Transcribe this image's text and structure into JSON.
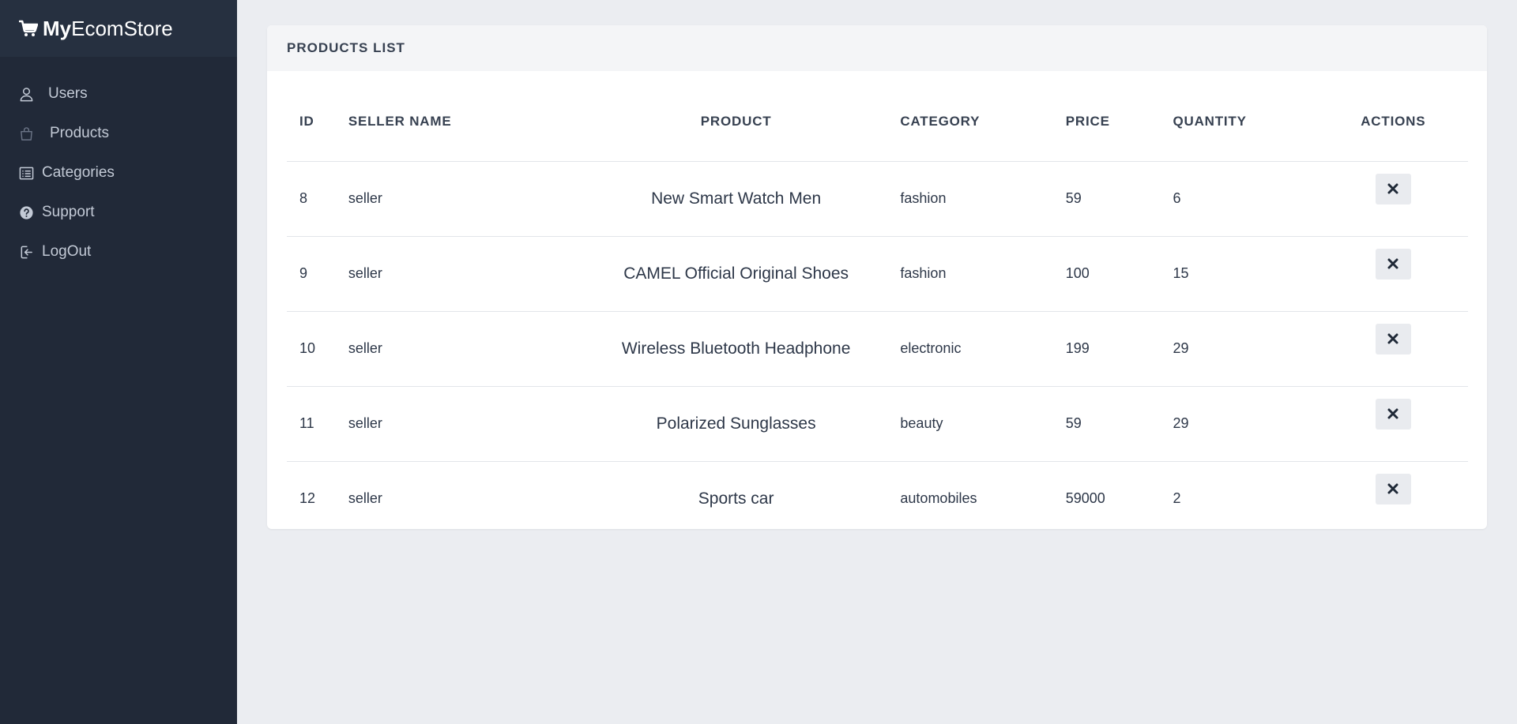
{
  "brand": {
    "bold": "My",
    "rest": "EcomStore",
    "icon": "cart-icon"
  },
  "sidebar": {
    "items": [
      {
        "label": "Users",
        "icon": "user-icon"
      },
      {
        "label": "Products",
        "icon": "shopping-bag-icon"
      },
      {
        "label": "Categories",
        "icon": "list-icon"
      },
      {
        "label": "Support",
        "icon": "question-circle-icon"
      },
      {
        "label": "LogOut",
        "icon": "logout-icon"
      }
    ]
  },
  "card": {
    "title": "PRODUCTS LIST"
  },
  "table": {
    "headers": {
      "id": "ID",
      "seller": "SELLER NAME",
      "product": "PRODUCT",
      "category": "CATEGORY",
      "price": "PRICE",
      "quantity": "QUANTITY",
      "actions": "ACTIONS"
    },
    "rows": [
      {
        "id": "8",
        "seller": "seller",
        "product": "New Smart Watch Men",
        "category": "fashion",
        "price": "59",
        "quantity": "6"
      },
      {
        "id": "9",
        "seller": "seller",
        "product": "CAMEL Official Original Shoes",
        "category": "fashion",
        "price": "100",
        "quantity": "15"
      },
      {
        "id": "10",
        "seller": "seller",
        "product": "Wireless Bluetooth Headphone",
        "category": "electronic",
        "price": "199",
        "quantity": "29"
      },
      {
        "id": "11",
        "seller": "seller",
        "product": "Polarized Sunglasses",
        "category": "beauty",
        "price": "59",
        "quantity": "29"
      },
      {
        "id": "12",
        "seller": "seller",
        "product": "Sports car",
        "category": "automobiles",
        "price": "59000",
        "quantity": "2"
      }
    ]
  },
  "colors": {
    "sidebar_bg": "#212938",
    "brand_bg": "#263040",
    "page_bg": "#ebedf1"
  }
}
